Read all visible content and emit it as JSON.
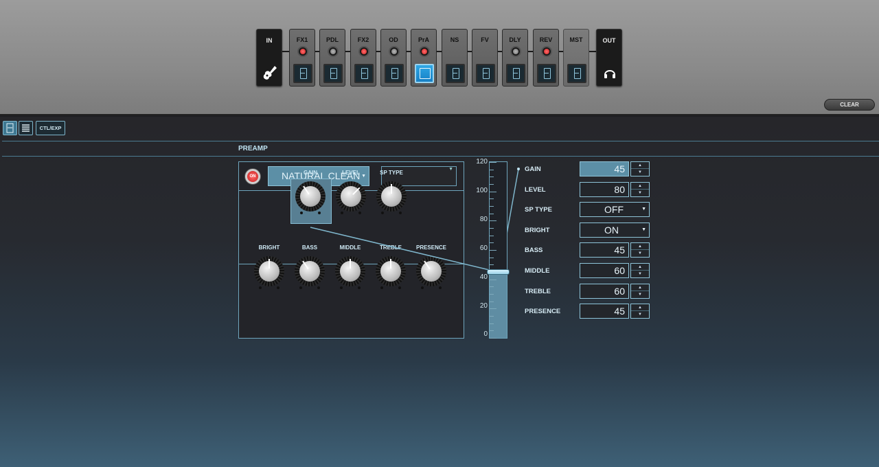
{
  "chain": {
    "in_label": "IN",
    "out_label": "OUT",
    "blocks": [
      {
        "label": "FX1",
        "led": "red"
      },
      {
        "label": "PDL",
        "led": "grey"
      },
      {
        "label": "FX2",
        "led": "red"
      },
      {
        "label": "OD",
        "led": "grey"
      },
      {
        "label": "PrA",
        "led": "red",
        "selected": true
      },
      {
        "label": "NS",
        "led": "none"
      },
      {
        "label": "FV",
        "led": "none"
      },
      {
        "label": "DLY",
        "led": "grey"
      },
      {
        "label": "REV",
        "led": "red"
      },
      {
        "label": "MST",
        "led": "none"
      }
    ],
    "clear_label": "CLEAR"
  },
  "toolbar": {
    "ctl_exp_label": "CTL/EXP"
  },
  "section": {
    "title": "PREAMP"
  },
  "amp": {
    "on_label": "ON",
    "type_value": "NATURAL CLEAN",
    "sub_value": "",
    "knobs_top": [
      {
        "label": "GAIN",
        "value": 45,
        "selected": true
      },
      {
        "label": "LEVEL",
        "value": 80
      },
      {
        "label": "SP TYPE",
        "value": 60
      }
    ],
    "knobs_bottom": [
      {
        "label": "BRIGHT",
        "value": 60
      },
      {
        "label": "BASS",
        "value": 45
      },
      {
        "label": "MIDDLE",
        "value": 60
      },
      {
        "label": "TREBLE",
        "value": 60
      },
      {
        "label": "PRESENCE",
        "value": 45
      }
    ]
  },
  "slider": {
    "value": 45,
    "max": 120,
    "scale": [
      "120",
      "100",
      "80",
      "60",
      "40",
      "20",
      "0"
    ]
  },
  "params": [
    {
      "name": "GAIN",
      "value": "45",
      "kind": "number",
      "highlight": true
    },
    {
      "name": "LEVEL",
      "value": "80",
      "kind": "number"
    },
    {
      "name": "SP TYPE",
      "value": "OFF",
      "kind": "select"
    },
    {
      "name": "BRIGHT",
      "value": "ON",
      "kind": "select"
    },
    {
      "name": "BASS",
      "value": "45",
      "kind": "number"
    },
    {
      "name": "MIDDLE",
      "value": "60",
      "kind": "number"
    },
    {
      "name": "TREBLE",
      "value": "60",
      "kind": "number"
    },
    {
      "name": "PRESENCE",
      "value": "45",
      "kind": "number"
    }
  ],
  "colors": {
    "accent": "#5c8fa6",
    "led_on": "#d22020",
    "selected_block": "#2fa7e6"
  },
  "icons": {
    "in": "guitar-icon",
    "out": "headphones-icon",
    "block": "pedal-icon"
  }
}
